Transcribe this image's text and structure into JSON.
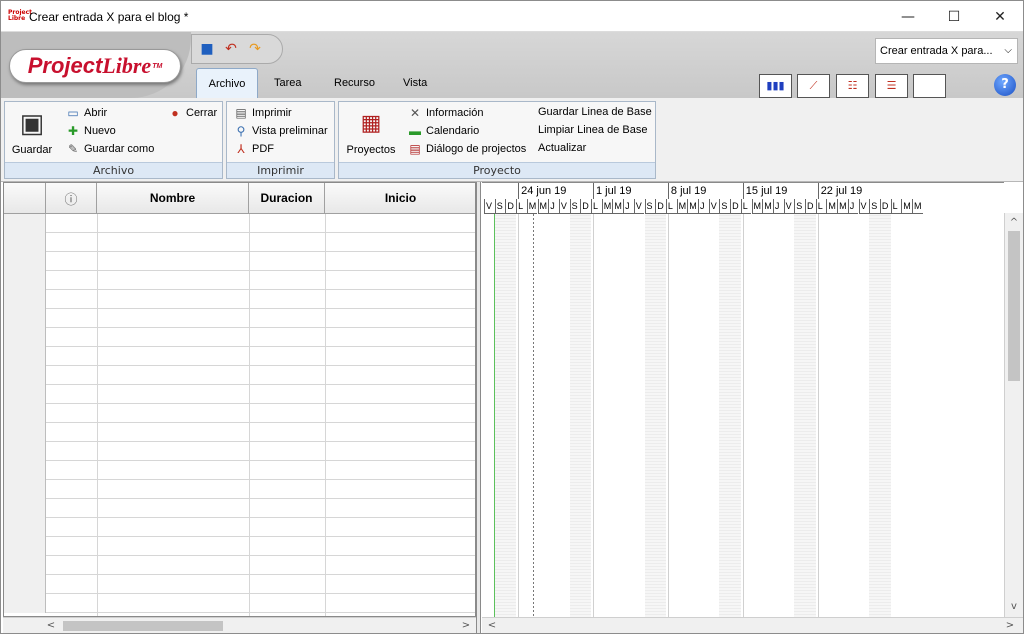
{
  "window": {
    "title": "Crear entrada X para el blog *",
    "app_icon_text": "Project Libre",
    "minimize": "—",
    "maximize": "☐",
    "close": "✕"
  },
  "logo": {
    "text_a": "Project",
    "text_b": "Libre",
    "tm": "TM"
  },
  "tabs": [
    {
      "label": "Archivo",
      "active": true
    },
    {
      "label": "Tarea"
    },
    {
      "label": "Recurso"
    },
    {
      "label": "Vista"
    }
  ],
  "project_selector": {
    "value": "Crear entrada X para...",
    "chevron": "⌵"
  },
  "help": {
    "label": "?"
  },
  "groups": {
    "archivo": {
      "label": "Archivo",
      "guardar": "Guardar",
      "abrir": "Abrir",
      "nuevo": "Nuevo",
      "guardar_como": "Guardar como",
      "cerrar": "Cerrar"
    },
    "imprimir": {
      "label": "Imprimir",
      "imprimir": "Imprimir",
      "vista_preliminar": "Vista preliminar",
      "pdf": "PDF"
    },
    "proyecto": {
      "label": "Proyecto",
      "proyectos": "Proyectos",
      "informacion": "Información",
      "calendario": "Calendario",
      "dialogo": "Diálogo de projectos",
      "guardar_linea": "Guardar Linea de Base",
      "limpiar_linea": "Limpiar Linea de Base",
      "actualizar": "Actualizar"
    }
  },
  "grid": {
    "columns": [
      {
        "label": ""
      },
      {
        "label": "ⓘ"
      },
      {
        "label": "Nombre"
      },
      {
        "label": "Duracion"
      },
      {
        "label": "Inicio"
      }
    ],
    "row_count": 21
  },
  "gantt": {
    "weeks": [
      "24 jun 19",
      "1 jul 19",
      "8 jul 19",
      "15 jul 19",
      "22 jul 19"
    ],
    "days": [
      "V",
      "S",
      "D",
      "L",
      "M",
      "M",
      "J",
      "V",
      "S",
      "D",
      "L",
      "M",
      "M",
      "J",
      "V",
      "S",
      "D",
      "L",
      "M",
      "M",
      "J",
      "V",
      "S",
      "D",
      "L",
      "M",
      "M",
      "J",
      "V",
      "S",
      "D",
      "L",
      "M",
      "M",
      "J",
      "V",
      "S",
      "D",
      "L",
      "M",
      "M"
    ]
  },
  "scroll": {
    "left": "<",
    "right": ">",
    "up": "^",
    "down": "v"
  }
}
